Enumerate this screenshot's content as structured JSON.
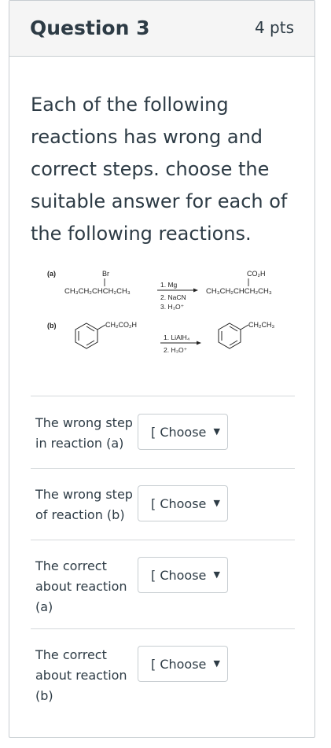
{
  "question": {
    "title": "Question 3",
    "points": "4 pts",
    "prompt": "Each of the following reactions has wrong and correct steps. choose the suitable answer for each of the following reactions."
  },
  "scheme": {
    "a": {
      "label": "(a)",
      "substituent_top": "Br",
      "reactant": "CH₃CH₂CHCH₂CH₃",
      "steps": [
        "1. Mg",
        "2. NaCN",
        "3. H₃O⁺"
      ],
      "product_top": "CO₂H",
      "product": "CH₃CH₂CHCH₂CH₃"
    },
    "b": {
      "label": "(b)",
      "reactant_group": "CH₂CO₂H",
      "steps": [
        "1. LiAlH₄",
        "2. H₃O⁺"
      ],
      "product_group": "CH₂CH₃"
    }
  },
  "answers": [
    {
      "label": "The wrong step in reaction (a)",
      "selected": "[ Choose ]"
    },
    {
      "label": "The wrong step of reaction (b)",
      "selected": "[ Choose ]"
    },
    {
      "label": "The correct about reaction (a)",
      "selected": "[ Choose ]"
    },
    {
      "label": "The correct about reaction (b)",
      "selected": "[ Choose ]"
    }
  ],
  "icons": {
    "dropdown": "caret-down-icon"
  },
  "colors": {
    "accent": "#0374b5",
    "header_bg": "#f5f5f5",
    "text": "#2d3b45",
    "border": "#c7cdd1"
  }
}
